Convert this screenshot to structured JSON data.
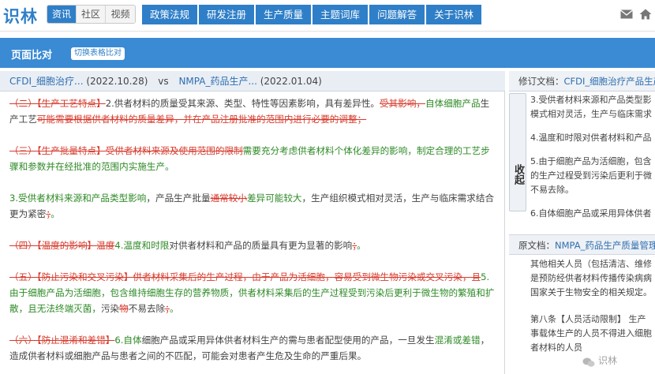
{
  "app": {
    "logo": "识林"
  },
  "top_tabs": [
    "资讯",
    "社区",
    "视频"
  ],
  "main_nav": [
    "政策法规",
    "研发注册",
    "生产质量",
    "主题词库",
    "问题解答",
    "关于识林"
  ],
  "header": {
    "title": "页面比对",
    "switch_label": "切换表格比对"
  },
  "compare": {
    "left_doc": "CFDI_细胞治疗...",
    "left_date": "(2022.10.28)",
    "vs": "vs",
    "right_doc": "NMPA_药品生产...",
    "right_date": "(2022.01.04)"
  },
  "diff": {
    "p1": {
      "d1": "（二）【生产工艺特点】",
      "t1": "2.供者材料的质量受其来源、类型、特性等因素影响，具有差异性。",
      "d2": "受其影响，",
      "i1": "自体细胞产品",
      "t2": "生产工艺",
      "d3": "可能需要根据供者材料的质量差异，并在产品注册批准的范围内进行必要的调整；"
    },
    "p2": {
      "d1": "（三）【生产批量特点】",
      "d2": "受供者材料来源及使用范围的限制",
      "i1": "需要充分考虑供者材料个体化差异的影响，制定合理的工艺步骤和参数并在经批准的范围内实施生产。"
    },
    "p3": {
      "i1": "3.受供者材料来源和产品类型影响",
      "t1": "，产品生产批量",
      "d1": "通常较小",
      "i2": "差异可能较大",
      "t2": "，生产组织模式相对灵活，生产与临床需求结合更为紧密",
      "d2": "；",
      "i3": "。"
    },
    "p4": {
      "d1": "（四）【温度的影响】",
      "d2": "温度",
      "i1": "4.温度和时限",
      "t1": "对供者材料和产品的质量具有更为显著的影响",
      "d3": "；",
      "i2": "。"
    },
    "p5": {
      "d1": "（五）【防止污染和交叉污染】",
      "d2": "供者材料采集后的生产过程，由于产品为活细胞，容易受到微生物污染或交叉污染，且",
      "i1": "5.由于细胞产品为活细胞，包含维持细胞生存的营养物质，供者材料采集后的生产过程受到污染后更利于微生物的繁殖和扩散，且无法终端灭菌，",
      "t1": "污染",
      "d3": "物",
      "t2": "不易去除",
      "d4": "；",
      "i2": "。"
    },
    "p6": {
      "d1": "（六）【防止混淆和差错】",
      "i1": "6.自体",
      "t1": "细胞产品或采用异体供者材料生产的需与患者配型使用的产品，一旦发生",
      "i2": "混淆或差错",
      "t2": "，造成供者材料或细胞产品与患者之间的不匹配，可能会对患者产生危及生命的严重后果。"
    }
  },
  "revised": {
    "label": "修订文档：",
    "doc": "CFDI_细胞治疗产品生产",
    "collapse": "收起",
    "lines": [
      [
        "3.受供者材料来源和产品类型影",
        "模式相对灵活，生产与临床需求"
      ],
      [
        "4.温度和时限对供者材料和产品"
      ],
      [
        "5.由于细胞产品为活细胞，包含",
        "的生产过程受到污染后更利于微",
        "不易去除。"
      ],
      [
        "6.自体细胞产品或采用异体供者"
      ]
    ]
  },
  "original": {
    "label": "原文档：",
    "doc": "NMPA_药品生产质量管理",
    "lines_a": [
      "其他相关人员（包括清洁、维修",
      "是预防经供者材料传播传染病病",
      "国家关于生物安全的相关规定。"
    ],
    "lines_b": [
      "第八条【人员活动限制】 生产",
      "事载体生产的人员不得进入细胞",
      "者材料的人员"
    ]
  },
  "watermark": "识林"
}
